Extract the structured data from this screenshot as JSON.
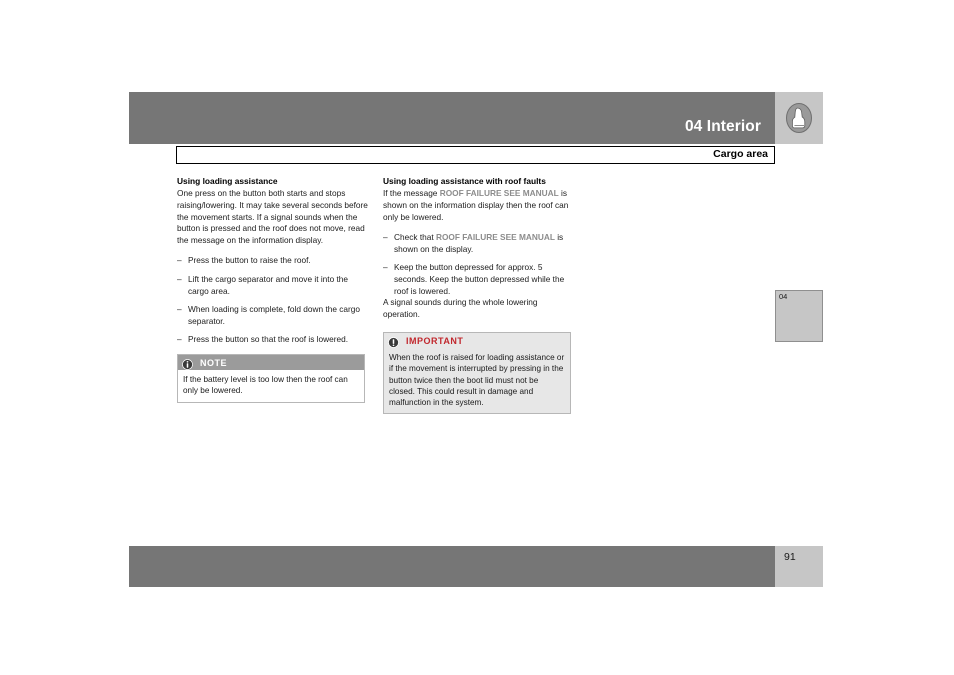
{
  "header": {
    "title": "04 Interior",
    "icon": "seat-interior-icon"
  },
  "section": {
    "title": "Cargo area"
  },
  "left_column": {
    "heading": "Using loading assistance",
    "intro": "One press on the button both starts and stops raising/lowering. It may take several seconds before the movement starts. If a signal sounds when the button is pressed and the roof does not move, read the message on the information display.",
    "steps": [
      "Press the button to raise the roof.",
      "Lift the cargo separator and move it into the cargo area.",
      "When loading is complete, fold down the cargo separator.",
      "Press the button so that the roof is lowered."
    ],
    "note": {
      "icon": "info-icon",
      "title": "NOTE",
      "text": "If the battery level is too low then the roof can only be lowered."
    }
  },
  "right_column": {
    "heading": "Using loading assistance with roof faults",
    "intro_part1": "If the message ",
    "intro_message": "ROOF FAILURE SEE MANUAL",
    "intro_part2": " is shown on the information display then the roof can only be lowered.",
    "steps": [
      {
        "part1": "Check that ",
        "message": "ROOF FAILURE SEE MANUAL",
        "part2": " is shown on the display."
      },
      {
        "part1": "Keep the button depressed for approx. 5 seconds. Keep the button depressed while the roof is lowered.",
        "message": "",
        "part2": ""
      }
    ],
    "closing": "A signal sounds during the whole lowering operation.",
    "important": {
      "icon": "warning-exclamation-icon",
      "title": "IMPORTANT",
      "text": "When the roof is raised for loading assistance or if the movement is interrupted by pressing in the button twice then the boot lid must not be closed. This could result in damage and malfunction in the system."
    }
  },
  "chapter_tab": {
    "label": "04"
  },
  "footer": {
    "page_number": "91"
  },
  "colors": {
    "header_gray": "#767676",
    "tab_gray": "#c6c6c6",
    "note_header_gray": "#9b9b9b",
    "important_red": "#c1272d",
    "important_bg": "#e7e7e7",
    "message_gray": "#8c8c8c"
  }
}
